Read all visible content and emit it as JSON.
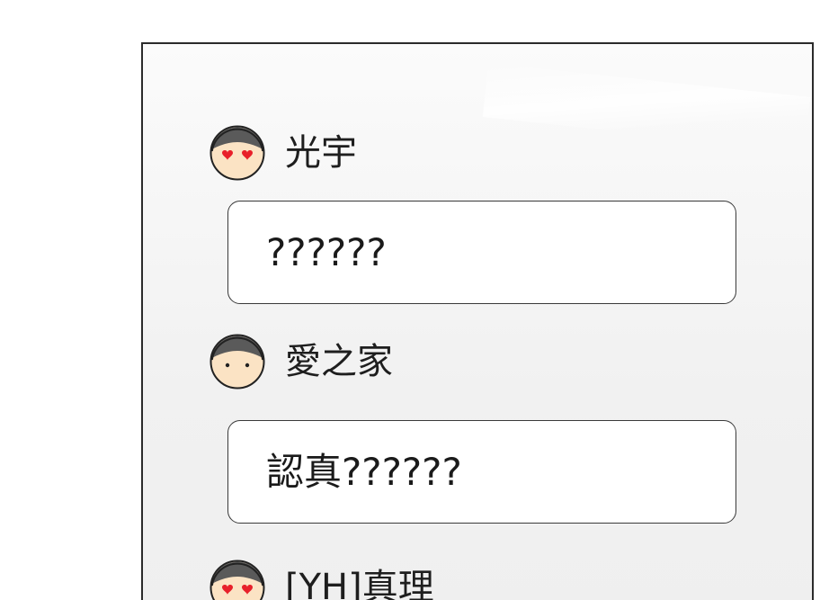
{
  "messages": [
    {
      "avatar": "heart-eyes-avatar-icon",
      "username": "光宇",
      "text": "??????"
    },
    {
      "avatar": "dot-eyes-avatar-icon",
      "username": "愛之家",
      "text": "認真??????"
    },
    {
      "avatar": "heart-eyes-avatar-icon",
      "username": "[YH]真理",
      "text": ""
    }
  ],
  "colors": {
    "frame": "#2b2b2b",
    "panel_background": "#f3f3f3",
    "bubble_background": "#ffffff",
    "avatar_hair": "#5a5a5a",
    "avatar_skin": "#fbe3c4",
    "heart": "#e8202a"
  }
}
